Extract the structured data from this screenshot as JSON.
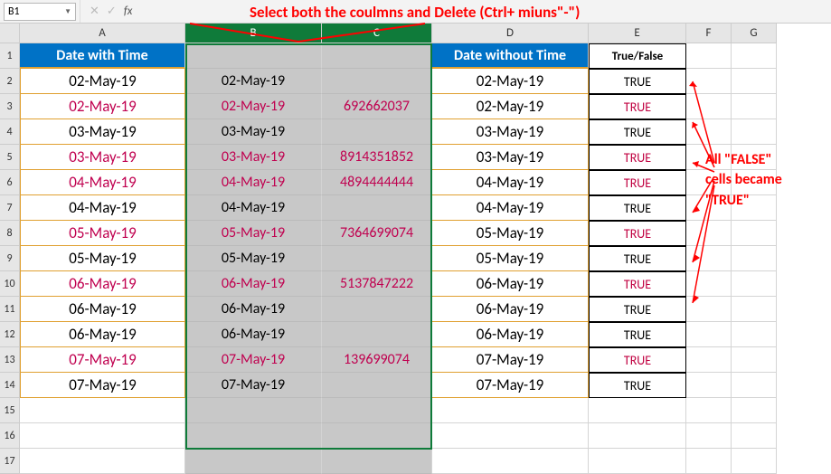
{
  "nameBox": "B1",
  "annotations": {
    "top": "Select both the coulmns and Delete (Ctrl+ miuns\"-\")",
    "right_l1": "All \"FALSE\"",
    "right_l2": "cells became",
    "right_l3": "\"TRUE\""
  },
  "headers": {
    "A": "Date with Time",
    "B": "",
    "C": "",
    "D": "Date without Time",
    "E": "True/False"
  },
  "colLetters": [
    "A",
    "B",
    "C",
    "D",
    "E",
    "F",
    "G"
  ],
  "rows": [
    {
      "a": "02-May-19",
      "b": "02-May-19",
      "c": "",
      "d": "02-May-19",
      "e": "TRUE",
      "hl": false
    },
    {
      "a": "02-May-19",
      "b": "02-May-19",
      "c": "692662037",
      "d": "02-May-19",
      "e": "TRUE",
      "hl": true
    },
    {
      "a": "03-May-19",
      "b": "03-May-19",
      "c": "",
      "d": "03-May-19",
      "e": "TRUE",
      "hl": false
    },
    {
      "a": "03-May-19",
      "b": "03-May-19",
      "c": "8914351852",
      "d": "03-May-19",
      "e": "TRUE",
      "hl": true
    },
    {
      "a": "04-May-19",
      "b": "04-May-19",
      "c": "4894444444",
      "d": "04-May-19",
      "e": "TRUE",
      "hl": true
    },
    {
      "a": "04-May-19",
      "b": "04-May-19",
      "c": "",
      "d": "04-May-19",
      "e": "TRUE",
      "hl": false
    },
    {
      "a": "05-May-19",
      "b": "05-May-19",
      "c": "7364699074",
      "d": "05-May-19",
      "e": "TRUE",
      "hl": true
    },
    {
      "a": "05-May-19",
      "b": "05-May-19",
      "c": "",
      "d": "05-May-19",
      "e": "TRUE",
      "hl": false
    },
    {
      "a": "06-May-19",
      "b": "06-May-19",
      "c": "5137847222",
      "d": "06-May-19",
      "e": "TRUE",
      "hl": true
    },
    {
      "a": "06-May-19",
      "b": "06-May-19",
      "c": "",
      "d": "06-May-19",
      "e": "TRUE",
      "hl": false
    },
    {
      "a": "06-May-19",
      "b": "06-May-19",
      "c": "",
      "d": "06-May-19",
      "e": "TRUE",
      "hl": false
    },
    {
      "a": "07-May-19",
      "b": "07-May-19",
      "c": "139699074",
      "d": "07-May-19",
      "e": "TRUE",
      "hl": true
    },
    {
      "a": "07-May-19",
      "b": "07-May-19",
      "c": "",
      "d": "07-May-19",
      "e": "TRUE",
      "hl": false
    }
  ]
}
